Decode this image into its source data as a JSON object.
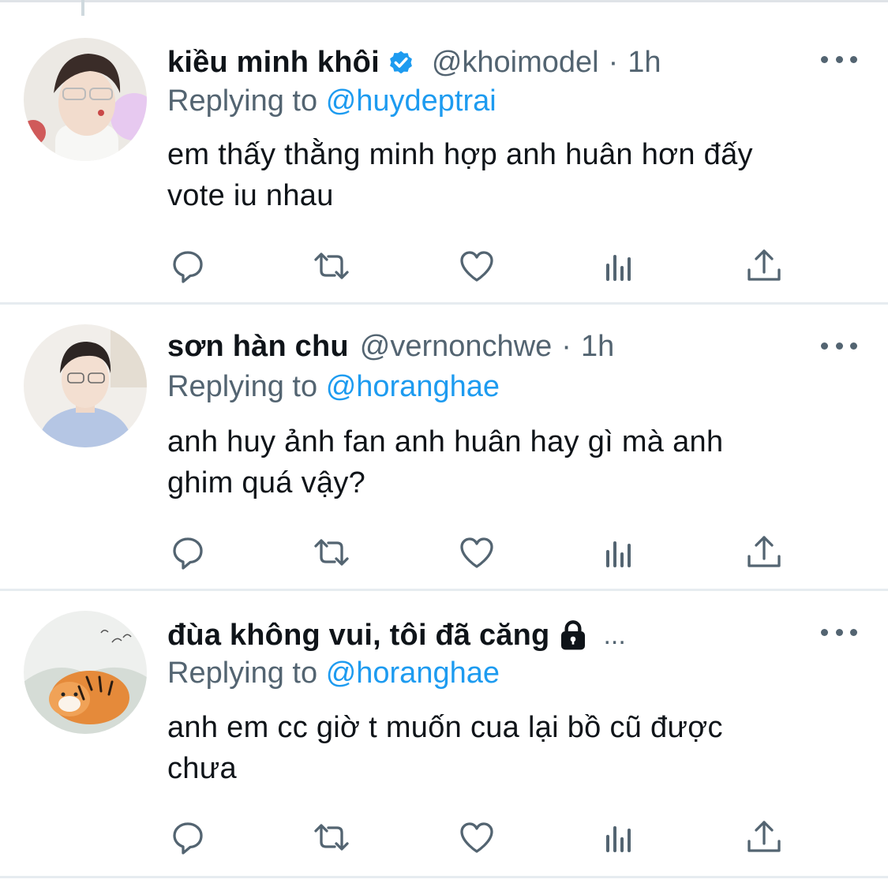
{
  "colors": {
    "accent": "#1d9bf0",
    "secondary_text": "#536471",
    "primary_text": "#0f1419",
    "divider": "#e6ecf0"
  },
  "tweets": [
    {
      "display_name": "kiều minh khôi",
      "verified": true,
      "handle": "@khoimodel",
      "separator": "·",
      "time": "1h",
      "replying_prefix": "Replying to",
      "replying_to": "@huydeptrai",
      "text_line1": "em thấy thằng minh hợp anh huân hơn đấy",
      "text_line2": "vote iu nhau",
      "avatar_icon": "avatar-photo"
    },
    {
      "display_name": "sơn hàn chu",
      "verified": false,
      "handle": "@vernonchwe",
      "separator": "·",
      "time": "1h",
      "replying_prefix": "Replying to",
      "replying_to": "@horanghae",
      "text_line1": "anh huy ảnh fan anh huân hay gì mà anh",
      "text_line2": "ghim quá vậy?",
      "avatar_icon": "avatar-photo"
    },
    {
      "display_name": "đùa không vui, tôi đã căng",
      "locked": true,
      "truncation": "...",
      "replying_prefix": "Replying to",
      "replying_to": "@horanghae",
      "text_line1": "anh em cc giờ t muốn cua lại bồ cũ được",
      "text_line2": "chưa",
      "avatar_icon": "tiger-illustration"
    }
  ],
  "action_icons": [
    "reply-icon",
    "retweet-icon",
    "like-icon",
    "views-icon",
    "share-icon"
  ]
}
